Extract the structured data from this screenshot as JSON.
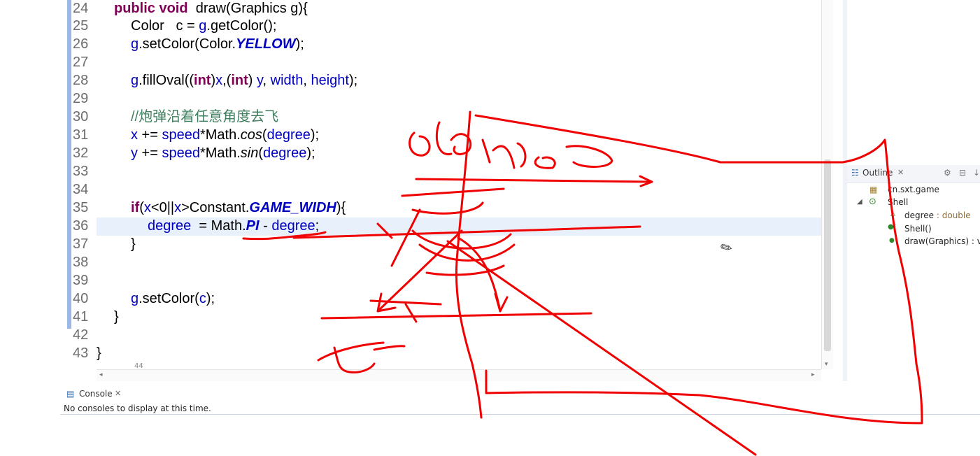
{
  "editor": {
    "line_numbers": [
      "24",
      "25",
      "26",
      "27",
      "28",
      "29",
      "30",
      "31",
      "32",
      "33",
      "34",
      "35",
      "36",
      "37",
      "38",
      "39",
      "40",
      "41",
      "42",
      "43"
    ],
    "lines": {
      "l24": {
        "kw1": "public",
        "kw2": "void",
        "rest": "draw(Graphics g){"
      },
      "l25": {
        "a": "Color   c = ",
        "b": "g",
        "c": ".getColor();"
      },
      "l26": {
        "a": "g",
        "b": ".setColor(Color.",
        "c": "YELLOW",
        "d": ");"
      },
      "l28": {
        "a": "g",
        "b": ".fillOval((",
        "kw": "int",
        "c": ")",
        "d": "x",
        ",": ",(",
        "kw2": "int",
        "e": ") ",
        "f": "y",
        ",2": ", ",
        "g": "width",
        ",3": ", ",
        "h": "height",
        "i": ");"
      },
      "l30": {
        "comment": "//炮弹沿着任意角度去飞"
      },
      "l31": {
        "a": "x",
        "b": " += ",
        "c": "speed",
        "d": "*Math.",
        "e": "cos",
        "f": "(",
        "g": "degree",
        "h": ");"
      },
      "l32": {
        "a": "y",
        "b": " += ",
        "c": "speed",
        "d": "*Math.",
        "e": "sin",
        "f": "(",
        "g": "degree",
        "h": ");"
      },
      "l35": {
        "kw": "if",
        "a": "(",
        "b": "x",
        "c": "<0||",
        "d": "x",
        "e": ">Constant.",
        "f": "GAME_WIDH",
        "g": "){"
      },
      "l36": {
        "a": "degree",
        "b": "  = Math.",
        "c": "PI",
        "d": " - ",
        "e": "degree",
        "f": ";"
      },
      "l37": {
        "a": "}"
      },
      "l40": {
        "a": "g",
        "b": ".setColor(",
        "c": "c",
        "d": ");"
      },
      "l41": {
        "a": "}"
      },
      "l43": {
        "a": "}"
      }
    }
  },
  "outline": {
    "tab_label": "Outline",
    "items": [
      {
        "label": "cn.sxt.game",
        "icon": "package-icon"
      },
      {
        "label": "Shell",
        "icon": "class-icon"
      },
      {
        "label": "degree",
        "type": " : double",
        "icon": "field-icon"
      },
      {
        "label": "Shell()",
        "icon": "constructor-icon"
      },
      {
        "label": "draw(Graphics) : v",
        "icon": "method-icon"
      }
    ]
  },
  "console": {
    "tab_label": "Console",
    "message": "No consoles to display at this time."
  },
  "colors": {
    "ink": "#f00000",
    "keyword": "#7f0055",
    "field": "#0000c0",
    "comment": "#3f7f5f"
  }
}
